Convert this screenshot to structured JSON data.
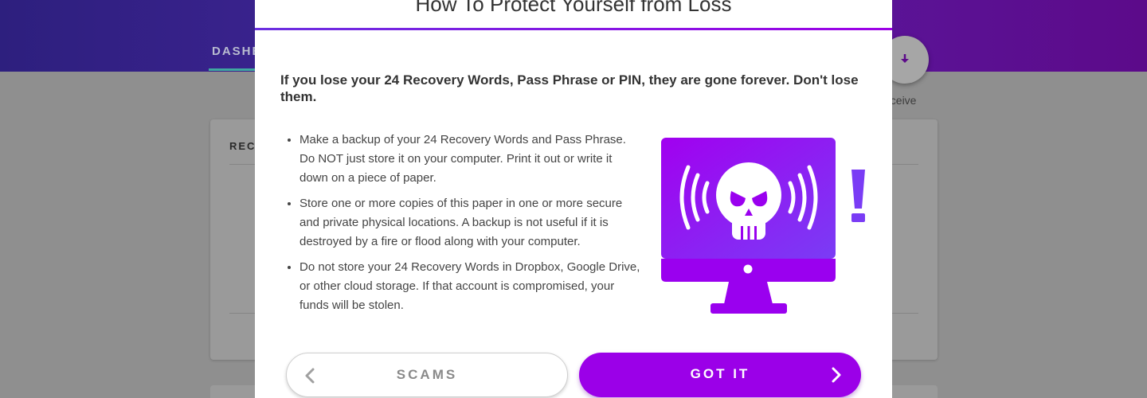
{
  "background": {
    "tab_label": "DASHE",
    "card_title": "RECE",
    "receive_label": "eceive"
  },
  "modal": {
    "title": "How To Protect Yourself from Loss",
    "lead": "If you lose your 24 Recovery Words, Pass Phrase or PIN, they are gone forever. Don't lose them.",
    "bullets": [
      "Make a backup of your 24 Recovery Words and Pass Phrase. Do NOT just store it on your computer. Print it out or write it down on a piece of paper.",
      "Store one or more copies of this paper in one or more secure and private physical locations. A backup is not useful if it is destroyed by a fire or flood along with your computer.",
      "Do not store your 24 Recovery Words in Dropbox, Google Drive, or other cloud storage. If that account is compromised, your funds will be stolen."
    ],
    "back_label": "SCAMS",
    "next_label": "GOT IT",
    "illustration_icon": "hacked-computer-skull-icon"
  },
  "colors": {
    "accent": "#9b00e8",
    "header_start": "#2d1f7e",
    "header_end": "#5c0a8a"
  }
}
